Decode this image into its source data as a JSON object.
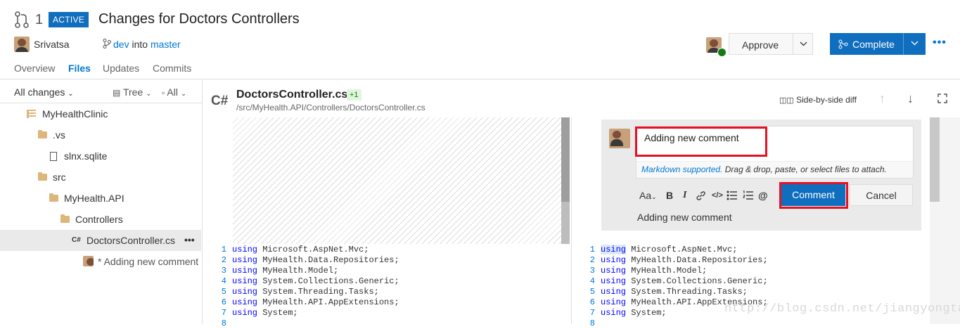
{
  "header": {
    "pr_number": "1",
    "status": "ACTIVE",
    "title": "Changes for Doctors Controllers",
    "author": "Srivatsa",
    "source_branch": "dev",
    "into": "into",
    "target_branch": "master"
  },
  "tabs": [
    {
      "label": "Overview"
    },
    {
      "label": "Files"
    },
    {
      "label": "Updates"
    },
    {
      "label": "Commits"
    }
  ],
  "actions": {
    "approve": "Approve",
    "complete": "Complete",
    "more": "•••"
  },
  "filter": {
    "all_changes": "All changes",
    "tree": "Tree",
    "all": "All"
  },
  "tree": [
    {
      "label": "MyHealthClinic",
      "icon": "repo-icon"
    },
    {
      "label": ".vs",
      "icon": "folder-icon"
    },
    {
      "label": "slnx.sqlite",
      "icon": "file-icon"
    },
    {
      "label": "src",
      "icon": "folder-icon"
    },
    {
      "label": "MyHealth.API",
      "icon": "folder-icon"
    },
    {
      "label": "Controllers",
      "icon": "folder-icon"
    },
    {
      "label": "DoctorsController.cs",
      "icon": "csharp-icon",
      "prefix": "C#",
      "more": "•••"
    },
    {
      "label": "* Adding new comment",
      "icon": "avatar"
    }
  ],
  "file": {
    "lang": "C#",
    "name": "DoctorsController.cs",
    "badge": "+1",
    "path": "/src/MyHealth.API/Controllers/DoctorsController.cs",
    "diff_mode": "Side-by-side diff"
  },
  "comment": {
    "input_value": "Adding new comment",
    "hint_link": "Markdown supported.",
    "hint_text": "Drag & drop, paste, or select files to attach.",
    "format": "Aa",
    "submit": "Comment",
    "cancel": "Cancel",
    "preview": "Adding new comment"
  },
  "code": [
    {
      "n": "1",
      "kw": "using",
      "rest": " Microsoft.AspNet.Mvc;"
    },
    {
      "n": "2",
      "kw": "using",
      "rest": " MyHealth.Data.Repositories;"
    },
    {
      "n": "3",
      "kw": "using",
      "rest": " MyHealth.Model;"
    },
    {
      "n": "4",
      "kw": "using",
      "rest": " System.Collections.Generic;"
    },
    {
      "n": "5",
      "kw": "using",
      "rest": " System.Threading.Tasks;"
    },
    {
      "n": "6",
      "kw": "using",
      "rest": " MyHealth.API.AppExtensions;"
    },
    {
      "n": "7",
      "kw": "using",
      "rest": " System;"
    },
    {
      "n": "8",
      "kw": "",
      "rest": ""
    }
  ],
  "watermark": "http://blog.csdn.net/jiangyongtao",
  "colors": {
    "accent": "#106ebe",
    "link": "#0078d4",
    "highlight": "#e81123",
    "success": "#107c10"
  }
}
